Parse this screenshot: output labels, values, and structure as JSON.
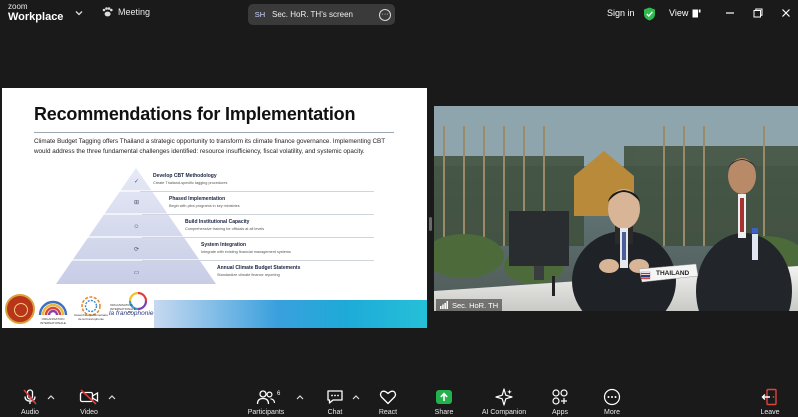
{
  "app": {
    "brand_top": "zoom",
    "brand_bottom": "Workplace",
    "meeting_label": "Meeting"
  },
  "share_pill": {
    "initials": "SH",
    "who": "Sec. HoR. TH's screen"
  },
  "header": {
    "sign_in": "Sign in",
    "view": "View"
  },
  "slide": {
    "title": "Recommendations for Implementation",
    "intro": "Climate Budget Tagging offers Thailand a strategic opportunity to transform its climate finance governance. Implementing CBT would address the three fundamental challenges identified: resource insufficiency, fiscal volatility, and systemic opacity.",
    "steps": [
      {
        "title": "Develop CBT Methodology",
        "sub": "Create Thailand-specific tagging procedures",
        "icon": "✓"
      },
      {
        "title": "Phased Implementation",
        "sub": "Begin with pilot programs in key ministries",
        "icon": "⊞"
      },
      {
        "title": "Build Institutional Capacity",
        "sub": "Comprehensive training for officials at all levels",
        "icon": "☺"
      },
      {
        "title": "System Integration",
        "sub": "Integrate with existing financial management systems",
        "icon": "⟳"
      },
      {
        "title": "Annual Climate Budget Statements",
        "sub": "Standardize climate finance reporting",
        "icon": "▭"
      }
    ],
    "logos": {
      "org2_caption": "ORGANISATION INTERNATIONALE",
      "org3_caption": "Assemblée parlementaire de la Francophonie",
      "francophonie": "la francophonie",
      "francophonie_caption": "ORGANISATION INTERNATIONALE DE"
    }
  },
  "video": {
    "participant_name": "Sec. HoR. TH",
    "nameplate": "THAILAND"
  },
  "toolbar": {
    "items": [
      {
        "key": "audio",
        "label": "Audio"
      },
      {
        "key": "video",
        "label": "Video"
      },
      {
        "key": "participants",
        "label": "Participants",
        "count": "6"
      },
      {
        "key": "chat",
        "label": "Chat"
      },
      {
        "key": "react",
        "label": "React"
      },
      {
        "key": "share",
        "label": "Share"
      },
      {
        "key": "ai",
        "label": "AI Companion"
      },
      {
        "key": "apps",
        "label": "Apps"
      },
      {
        "key": "more",
        "label": "More"
      },
      {
        "key": "leave",
        "label": "Leave"
      }
    ]
  },
  "colors": {
    "background": "#1a1a1a",
    "share_green": "#22b14c",
    "muted_red": "#e03a3a",
    "shield_green": "#2dbb4e",
    "leave_red": "#e0433a"
  }
}
